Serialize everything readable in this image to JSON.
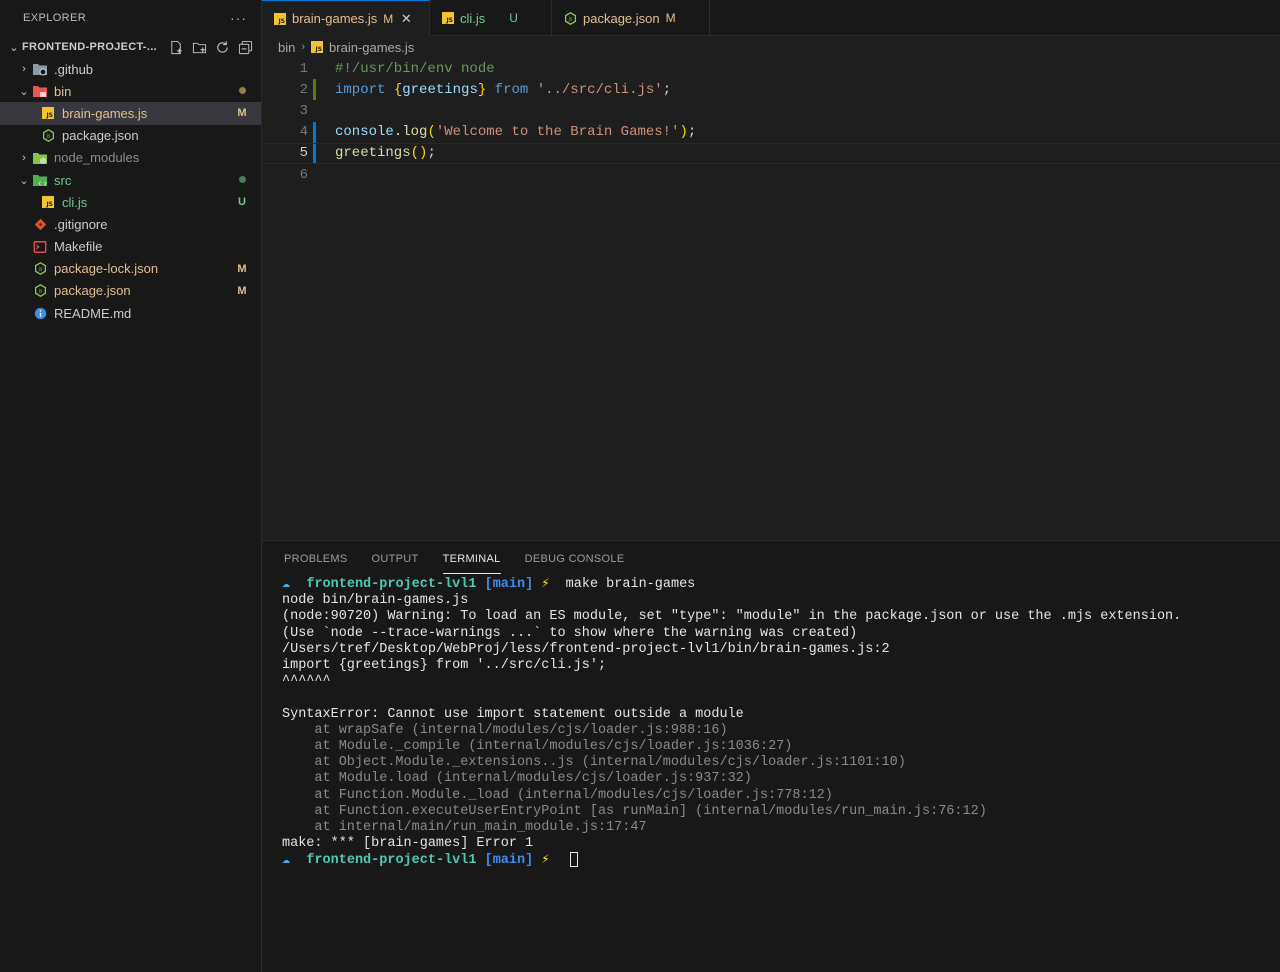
{
  "explorer": {
    "title": "EXPLORER",
    "more_label": "···",
    "project_name": "FRONTEND-PROJECT-...",
    "items": [
      {
        "label": ".github",
        "type": "folder",
        "expanded": false,
        "indent": 0,
        "badge": "",
        "color": "plain",
        "icon": "folder-github-icon"
      },
      {
        "label": "bin",
        "type": "folder",
        "expanded": true,
        "indent": 0,
        "badge": "●",
        "color": "mod",
        "icon": "folder-bin-icon"
      },
      {
        "label": "brain-games.js",
        "type": "file",
        "indent": 1,
        "badge": "M",
        "color": "mod",
        "icon": "js-file-icon",
        "selected": true
      },
      {
        "label": "package.json",
        "type": "file",
        "indent": 1,
        "badge": "",
        "color": "plain",
        "icon": "node-file-icon"
      },
      {
        "label": "node_modules",
        "type": "folder",
        "expanded": false,
        "indent": 0,
        "badge": "",
        "color": "dim",
        "icon": "folder-node-icon"
      },
      {
        "label": "src",
        "type": "folder",
        "expanded": true,
        "indent": 0,
        "badge": "●",
        "color": "untracked",
        "icon": "folder-src-icon"
      },
      {
        "label": "cli.js",
        "type": "file",
        "indent": 1,
        "badge": "U",
        "color": "untracked",
        "icon": "js-file-icon"
      },
      {
        "label": ".gitignore",
        "type": "file",
        "indent": 0,
        "badge": "",
        "color": "plain",
        "icon": "git-file-icon"
      },
      {
        "label": "Makefile",
        "type": "file",
        "indent": 0,
        "badge": "",
        "color": "plain",
        "icon": "makefile-icon"
      },
      {
        "label": "package-lock.json",
        "type": "file",
        "indent": 0,
        "badge": "M",
        "color": "mod",
        "icon": "node-file-icon"
      },
      {
        "label": "package.json",
        "type": "file",
        "indent": 0,
        "badge": "M",
        "color": "mod",
        "icon": "node-file-icon"
      },
      {
        "label": "README.md",
        "type": "file",
        "indent": 0,
        "badge": "",
        "color": "plain",
        "icon": "info-file-icon"
      }
    ]
  },
  "tabs": [
    {
      "label": "brain-games.js",
      "badge": "M",
      "color": "mod",
      "active": true,
      "icon": "js-file-icon",
      "close": "✕"
    },
    {
      "label": "cli.js",
      "badge": "U",
      "color": "untracked",
      "active": false,
      "icon": "js-file-icon"
    },
    {
      "label": "package.json",
      "badge": "M",
      "color": "mod",
      "active": false,
      "icon": "node-file-icon"
    }
  ],
  "breadcrumb": {
    "folder": "bin",
    "file": "brain-games.js"
  },
  "editor": {
    "current_line": 5,
    "lines": [
      {
        "n": "1",
        "mark": "",
        "tokens": [
          {
            "t": "#!/usr/bin/env node",
            "c": "comment"
          }
        ]
      },
      {
        "n": "2",
        "mark": "warn",
        "tokens": [
          {
            "t": "import",
            "c": "kw"
          },
          {
            "t": " ",
            "c": "plain"
          },
          {
            "t": "{",
            "c": "brace"
          },
          {
            "t": "greetings",
            "c": "var"
          },
          {
            "t": "}",
            "c": "brace"
          },
          {
            "t": " ",
            "c": "plain"
          },
          {
            "t": "from",
            "c": "kw"
          },
          {
            "t": " ",
            "c": "plain"
          },
          {
            "t": "'../src/cli.js'",
            "c": "str"
          },
          {
            "t": ";",
            "c": "punct"
          }
        ]
      },
      {
        "n": "3",
        "mark": "",
        "tokens": []
      },
      {
        "n": "4",
        "mark": "mod",
        "tokens": [
          {
            "t": "console",
            "c": "var"
          },
          {
            "t": ".",
            "c": "punct"
          },
          {
            "t": "log",
            "c": "fn"
          },
          {
            "t": "(",
            "c": "brace"
          },
          {
            "t": "'Welcome to the Brain Games!'",
            "c": "str"
          },
          {
            "t": ")",
            "c": "brace"
          },
          {
            "t": ";",
            "c": "punct"
          }
        ]
      },
      {
        "n": "5",
        "mark": "mod",
        "tokens": [
          {
            "t": "greetings",
            "c": "fn"
          },
          {
            "t": "()",
            "c": "brace"
          },
          {
            "t": ";",
            "c": "punct"
          }
        ]
      },
      {
        "n": "6",
        "mark": "",
        "tokens": []
      }
    ]
  },
  "panel": {
    "tabs": [
      {
        "label": "PROBLEMS",
        "active": false
      },
      {
        "label": "OUTPUT",
        "active": false
      },
      {
        "label": "TERMINAL",
        "active": true
      },
      {
        "label": "DEBUG CONSOLE",
        "active": false
      }
    ]
  },
  "terminal": {
    "prompt_arrow": "☁",
    "prompt_dir": "frontend-project-lvl1",
    "prompt_branch": "[main]",
    "prompt_bolt": "⚡",
    "command": "make brain-games",
    "output": [
      {
        "text": "node bin/brain-games.js",
        "dim": false
      },
      {
        "text": "(node:90720) Warning: To load an ES module, set \"type\": \"module\" in the package.json or use the .mjs extension.",
        "dim": false
      },
      {
        "text": "(Use `node --trace-warnings ...` to show where the warning was created)",
        "dim": false
      },
      {
        "text": "/Users/tref/Desktop/WebProj/less/frontend-project-lvl1/bin/brain-games.js:2",
        "dim": false
      },
      {
        "text": "import {greetings} from '../src/cli.js';",
        "dim": false
      },
      {
        "text": "^^^^^^",
        "dim": false
      },
      {
        "text": "",
        "dim": false
      },
      {
        "text": "SyntaxError: Cannot use import statement outside a module",
        "dim": false
      },
      {
        "text": "    at wrapSafe (internal/modules/cjs/loader.js:988:16)",
        "dim": true
      },
      {
        "text": "    at Module._compile (internal/modules/cjs/loader.js:1036:27)",
        "dim": true
      },
      {
        "text": "    at Object.Module._extensions..js (internal/modules/cjs/loader.js:1101:10)",
        "dim": true
      },
      {
        "text": "    at Module.load (internal/modules/cjs/loader.js:937:32)",
        "dim": true
      },
      {
        "text": "    at Function.Module._load (internal/modules/cjs/loader.js:778:12)",
        "dim": true
      },
      {
        "text": "    at Function.executeUserEntryPoint [as runMain] (internal/modules/run_main.js:76:12)",
        "dim": true
      },
      {
        "text": "    at internal/main/run_main_module.js:17:47",
        "dim": true
      },
      {
        "text": "make: *** [brain-games] Error 1",
        "dim": false
      }
    ]
  },
  "colors": {
    "modified": "#e2c08d",
    "untracked": "#73c991",
    "accent": "#0078d4"
  }
}
